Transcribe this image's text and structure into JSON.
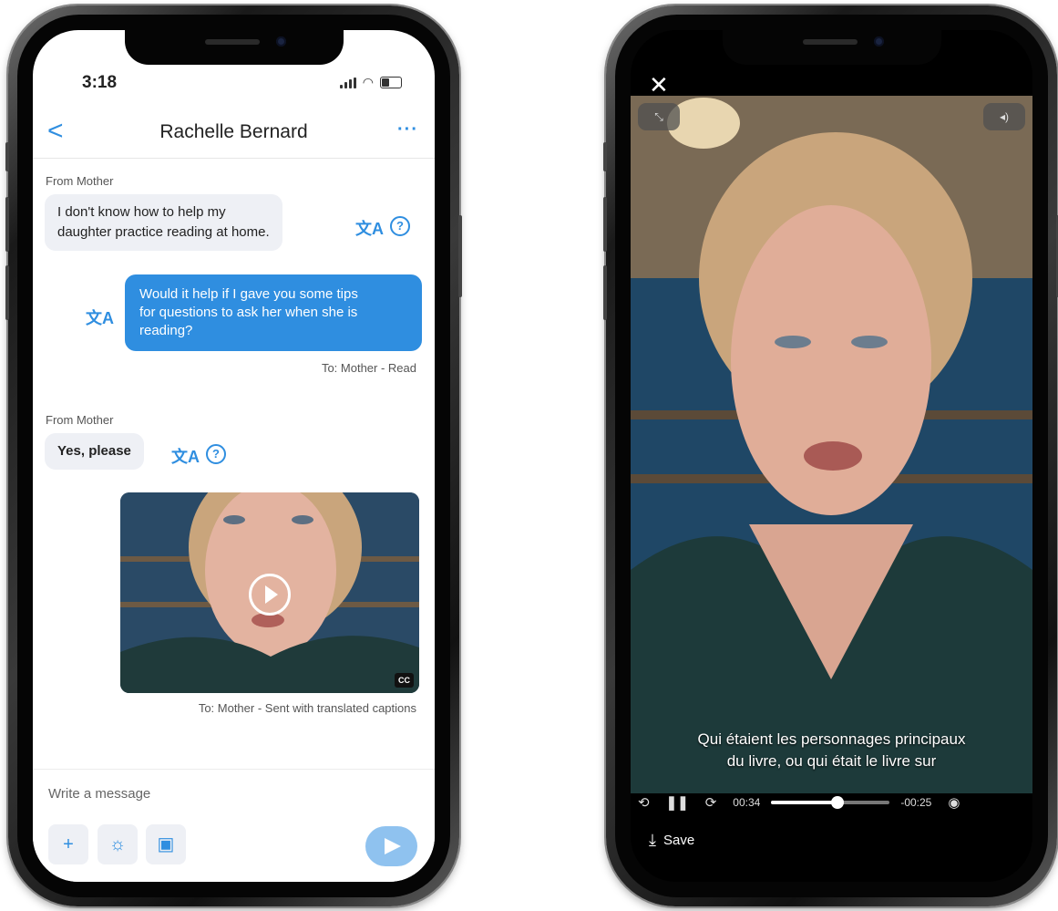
{
  "chat": {
    "status_time": "3:18",
    "contact_name": "Rachelle Bernard",
    "back_glyph": "<",
    "more_glyph": "···",
    "messages": [
      {
        "direction": "in",
        "from_label": "From Mother",
        "text_line1": "I don't know how to help my",
        "text_line2": "daughter practice reading at home."
      },
      {
        "direction": "out",
        "text_line1": "Would it help if I gave you some tips",
        "text_line2": "for questions to ask her when she is",
        "text_line3": "reading?",
        "meta": "To: Mother - Read"
      },
      {
        "direction": "in",
        "from_label": "From Mother",
        "text": "Yes, please"
      },
      {
        "direction": "out",
        "type": "video",
        "cc_label": "CC",
        "meta": "To: Mother - Sent with translated captions"
      }
    ],
    "composer": {
      "placeholder": "Write a message",
      "tools": [
        {
          "icon": "plus-icon",
          "glyph": "+"
        },
        {
          "icon": "lightbulb-icon",
          "glyph": "☼"
        },
        {
          "icon": "calendar-icon",
          "glyph": "▣"
        }
      ]
    },
    "icons": {
      "translate": "translate-icon",
      "help": "help-icon",
      "translate_glyph": "文A",
      "help_glyph": "?"
    },
    "colors": {
      "accent": "#2f8ee0",
      "bubble_in": "#eef0f5",
      "send_button": "#8fc2ef"
    }
  },
  "player": {
    "close_glyph": "✕",
    "collapse_glyph": "⤡",
    "volume_glyph": "◂)",
    "caption_line1": "Qui étaient les personnages principaux",
    "caption_line2": "du livre, ou qui était le livre sur",
    "elapsed": "00:34",
    "remaining": "-00:25",
    "progress_fraction": 0.56,
    "save_label": "Save",
    "control_glyphs": {
      "rewind": "⟲",
      "pause": "❚❚",
      "forward": "⟳",
      "captions": "◉"
    }
  }
}
